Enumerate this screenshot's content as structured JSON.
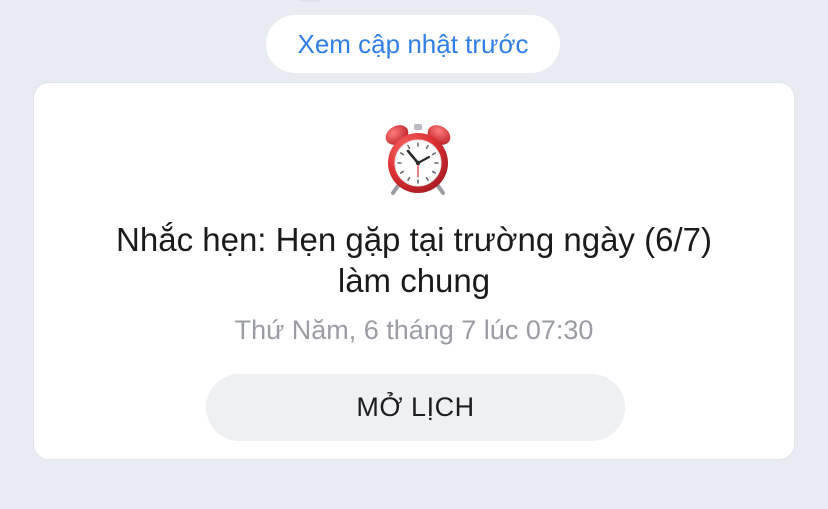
{
  "header": {
    "previous_updates_label": "Xem cập nhật trước"
  },
  "reminder_card": {
    "icon": "alarm-clock-icon",
    "title": "Nhắc hẹn: Hẹn gặp tại trường ngày (6/7)\nlàm chung",
    "timestamp": "Thứ Năm, 6 tháng 7 lúc 07:30",
    "open_calendar_label": "MỞ LỊCH"
  },
  "colors": {
    "background": "#e8ebf1",
    "link_blue": "#2f7fe6",
    "card_background": "#ffffff",
    "button_background": "#eef0f4",
    "clock_red": "#d93a3a"
  }
}
